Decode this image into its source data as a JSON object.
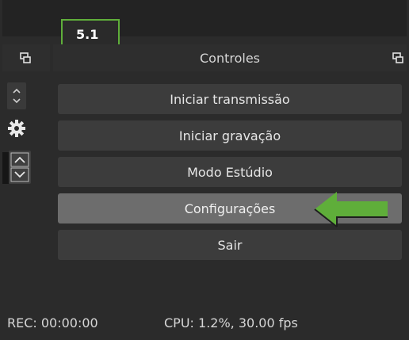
{
  "step_badge": "5.1",
  "dock": {
    "title": "Controles"
  },
  "buttons": [
    {
      "label": "Iniciar transmissão"
    },
    {
      "label": "Iniciar gravação"
    },
    {
      "label": "Modo Estúdio"
    },
    {
      "label": "Configurações",
      "active": true
    },
    {
      "label": "Sair"
    }
  ],
  "status": {
    "rec": "REC: 00:00:00",
    "cpu": "CPU: 1.2%, 30.00 fps"
  },
  "icons": {
    "undock": "undock-icon",
    "settings": "gear-icon",
    "arrows": "up-down-icon"
  },
  "colors": {
    "background": "#2b2b2b",
    "button": "#3c3c3c",
    "button_active": "#6d6d6d",
    "highlight_green": "#5fae3a"
  }
}
